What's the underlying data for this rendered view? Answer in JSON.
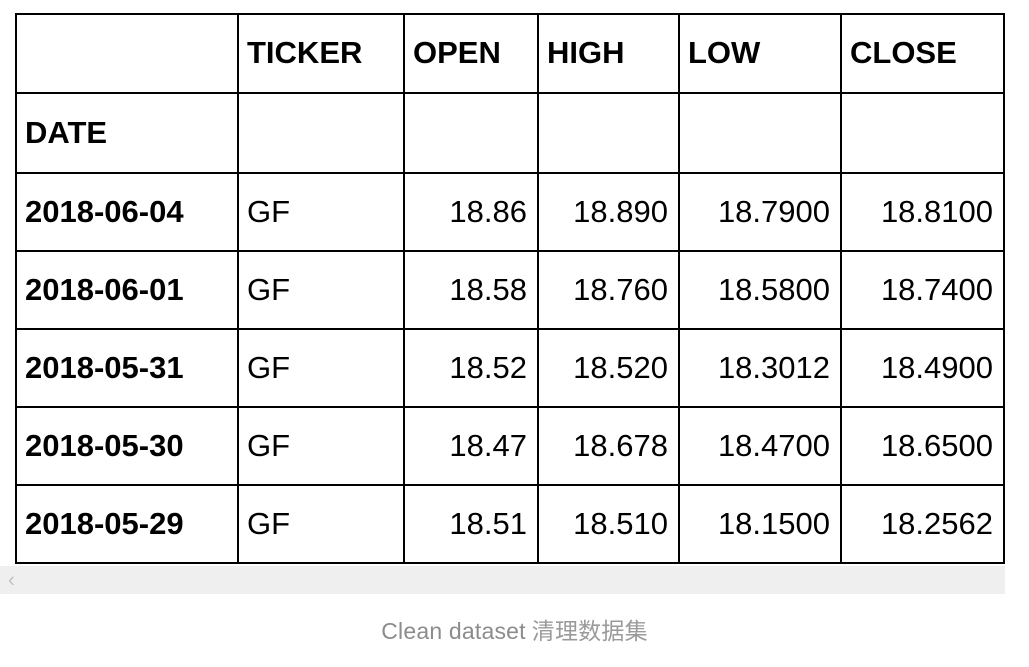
{
  "table": {
    "index_name": "DATE",
    "columns": [
      "TICKER",
      "OPEN",
      "HIGH",
      "LOW",
      "CLOSE"
    ],
    "corner_blank": "",
    "rows": [
      {
        "date": "2018-06-04",
        "ticker": "GF",
        "open": "18.86",
        "high": "18.890",
        "low": "18.7900",
        "close": "18.8100"
      },
      {
        "date": "2018-06-01",
        "ticker": "GF",
        "open": "18.58",
        "high": "18.760",
        "low": "18.5800",
        "close": "18.7400"
      },
      {
        "date": "2018-05-31",
        "ticker": "GF",
        "open": "18.52",
        "high": "18.520",
        "low": "18.3012",
        "close": "18.4900"
      },
      {
        "date": "2018-05-30",
        "ticker": "GF",
        "open": "18.47",
        "high": "18.678",
        "low": "18.4700",
        "close": "18.6500"
      },
      {
        "date": "2018-05-29",
        "ticker": "GF",
        "open": "18.51",
        "high": "18.510",
        "low": "18.1500",
        "close": "18.2562"
      }
    ]
  },
  "scrollbar": {
    "left_arrow_glyph": "‹"
  },
  "caption": {
    "english": "Clean dataset",
    "chinese": "清理数据集"
  },
  "colors": {
    "border": "#000000",
    "text": "#000000",
    "caption_text": "#8c8c8c",
    "scrollbar_track": "#efefef",
    "scrollbar_arrow": "#c2c2c2",
    "background": "#ffffff"
  }
}
